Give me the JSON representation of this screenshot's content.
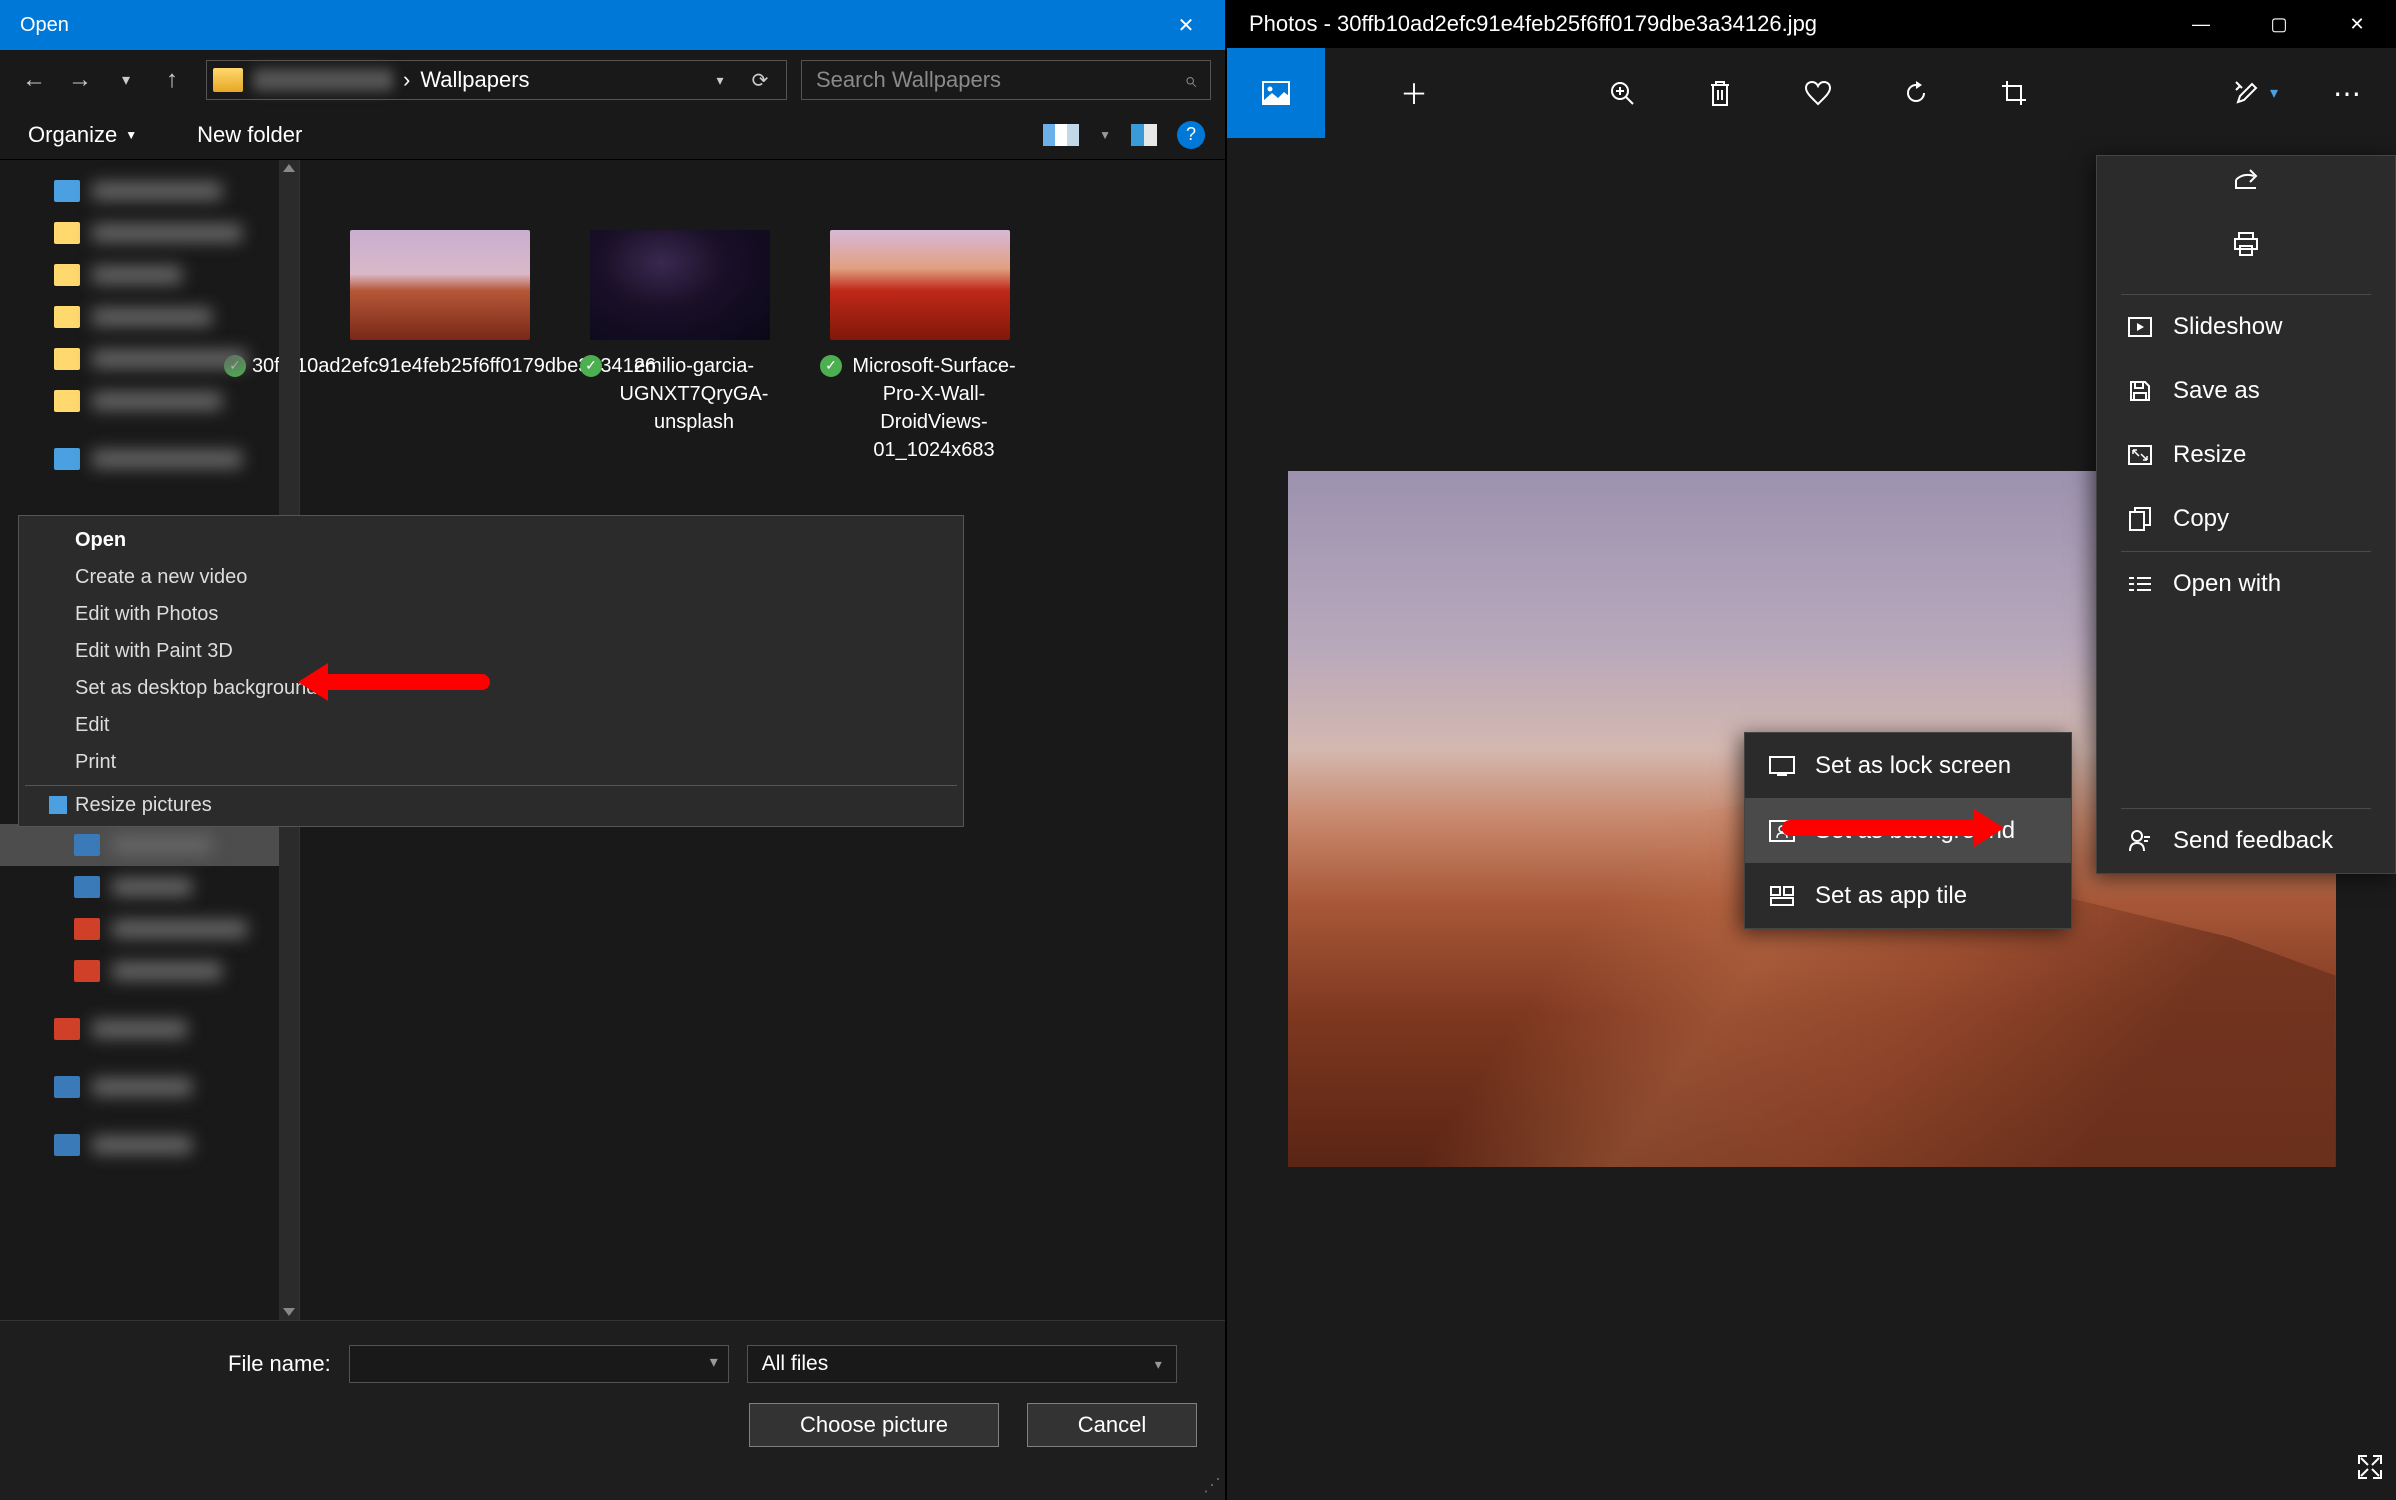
{
  "open_dialog": {
    "title": "Open",
    "breadcrumb": {
      "last": "Wallpapers",
      "sep": "›"
    },
    "search_placeholder": "Search Wallpapers",
    "organize": "Organize",
    "new_folder": "New folder",
    "files": [
      {
        "name": "30ffb10ad2efc91e4feb25f6ff0179dbe3a34126"
      },
      {
        "name": "emilio-garcia-UGNXT7QryGA-unsplash"
      },
      {
        "name": "Microsoft-Surface-Pro-X-Wall-DroidViews-01_1024x683"
      }
    ],
    "context_menu": {
      "open": "Open",
      "create_video": "Create a new video",
      "edit_photos": "Edit with Photos",
      "edit_paint3d": "Edit with Paint 3D",
      "set_desktop": "Set as desktop background",
      "edit": "Edit",
      "print": "Print",
      "resize": "Resize pictures"
    },
    "filename_label": "File name:",
    "filetype": "All files",
    "choose_btn": "Choose picture",
    "cancel_btn": "Cancel"
  },
  "photos_app": {
    "title": "Photos - 30ffb10ad2efc91e4feb25f6ff0179dbe3a34126.jpg",
    "more_menu": {
      "slideshow": "Slideshow",
      "save_as": "Save as",
      "resize": "Resize",
      "copy": "Copy",
      "open_with": "Open with",
      "send_feedback": "Send feedback"
    },
    "set_as_menu": {
      "lock_screen": "Set as lock screen",
      "background": "Set as background",
      "app_tile": "Set as app tile"
    }
  }
}
